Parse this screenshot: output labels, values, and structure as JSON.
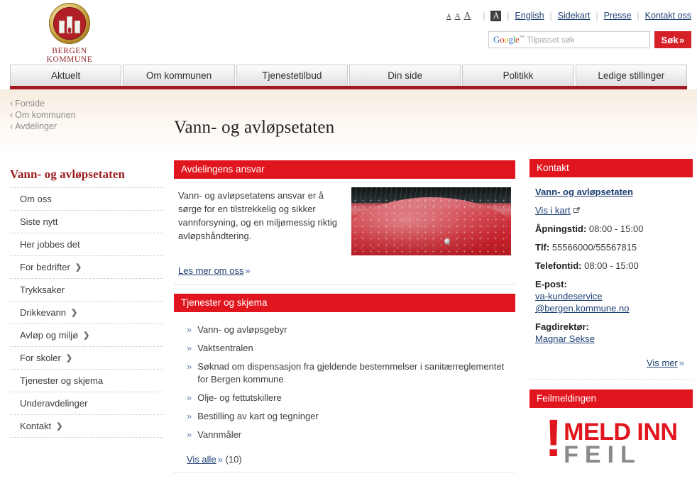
{
  "site": {
    "logo_text": "BERGEN KOMMUNE",
    "logo_icon": "bergen-coat-of-arms"
  },
  "utility": {
    "fontsize_small": "A",
    "fontsize_medium": "A",
    "fontsize_large": "A",
    "contrast_label": "A",
    "links": [
      {
        "label": "English"
      },
      {
        "label": "Sidekart"
      },
      {
        "label": "Presse"
      },
      {
        "label": "Kontakt oss"
      }
    ]
  },
  "search": {
    "value": "",
    "placeholder": "",
    "google_g": "G",
    "google_o1": "o",
    "google_o2": "o",
    "google_g2": "g",
    "google_l": "l",
    "google_e": "e",
    "google_tm": "™",
    "ghost_label": "Tilpasset søk",
    "button_label": "Søk",
    "button_icon": "double-chevron-right"
  },
  "mainnav": {
    "items": [
      {
        "label": "Aktuelt"
      },
      {
        "label": "Om kommunen"
      },
      {
        "label": "Tjenestetilbud"
      },
      {
        "label": "Din side"
      },
      {
        "label": "Politikk"
      },
      {
        "label": "Ledige stillinger"
      }
    ]
  },
  "breadcrumb": {
    "chevron": "‹",
    "items": [
      {
        "label": "Forside"
      },
      {
        "label": "Om kommunen"
      },
      {
        "label": "Avdelinger"
      }
    ]
  },
  "page": {
    "title": "Vann- og avløpsetaten"
  },
  "sidebar": {
    "heading": "Vann- og avløpsetaten",
    "arrow_glyph": "❯",
    "items": [
      {
        "label": "Om oss",
        "has_arrow": false
      },
      {
        "label": "Siste nytt",
        "has_arrow": false
      },
      {
        "label": "Her jobbes det",
        "has_arrow": false
      },
      {
        "label": "For bedrifter",
        "has_arrow": true
      },
      {
        "label": "Trykksaker",
        "has_arrow": false
      },
      {
        "label": "Drikkevann",
        "has_arrow": true
      },
      {
        "label": "Avløp og miljø",
        "has_arrow": true
      },
      {
        "label": "For skoler",
        "has_arrow": true
      },
      {
        "label": "Tjenester og skjema",
        "has_arrow": false
      },
      {
        "label": "Underavdelinger",
        "has_arrow": false
      },
      {
        "label": "Kontakt",
        "has_arrow": true
      }
    ]
  },
  "responsibility": {
    "heading": "Avdelingens ansvar",
    "body": "Vann- og avløpsetatens ansvar er å sørge for en tilstrekkelig og sikker vannforsyning, og en miljømessig riktig avløpshåndtering.",
    "link_label": "Les mer om oss",
    "link_chevron": "»",
    "image_name": "red-umbrella-in-rain-photo"
  },
  "services": {
    "heading": "Tjenester og skjema",
    "bullet": "»",
    "items": [
      {
        "label": "Vann- og avløpsgebyr"
      },
      {
        "label": "Vaktsentralen"
      },
      {
        "label": "Søknad om dispensasjon fra gjeldende bestemmelser i sanitærreglementet for Bergen kommune"
      },
      {
        "label": "Olje- og fettutskillere"
      },
      {
        "label": "Bestilling av kart og tegninger"
      },
      {
        "label": "Vannmåler"
      }
    ],
    "showall_label": "Vis alle",
    "showall_chevron": "»",
    "showall_count": "(10)"
  },
  "contact": {
    "heading": "Kontakt",
    "org_link": "Vann- og avløpsetaten",
    "map_link": "Vis i kart",
    "map_icon": "external-link-icon",
    "hours_label": "Åpningstid:",
    "hours_value": "08:00 - 15:00",
    "phone_label": "Tlf:",
    "phone_value": "55566000/55567815",
    "phonetime_label": "Telefontid:",
    "phonetime_value": "08:00 - 15:00",
    "email_label": "E-post:",
    "email_line1": "va-kundeservice",
    "email_line2": "@bergen.kommune.no",
    "director_label": "Fagdirektør:",
    "director_name": "Magnar Sekse",
    "more_label": "Vis mer",
    "more_chevron": "»"
  },
  "feilmelding": {
    "heading": "Feilmeldingen",
    "bang": "!",
    "line1": "MELD INN",
    "line2": "FEIL"
  },
  "colors": {
    "brand_red": "#e0151d",
    "bar_red": "#a4191f",
    "heading_red": "#9c1c1f",
    "link_blue": "#1d3f73",
    "gray_text": "#8a8a8a"
  }
}
